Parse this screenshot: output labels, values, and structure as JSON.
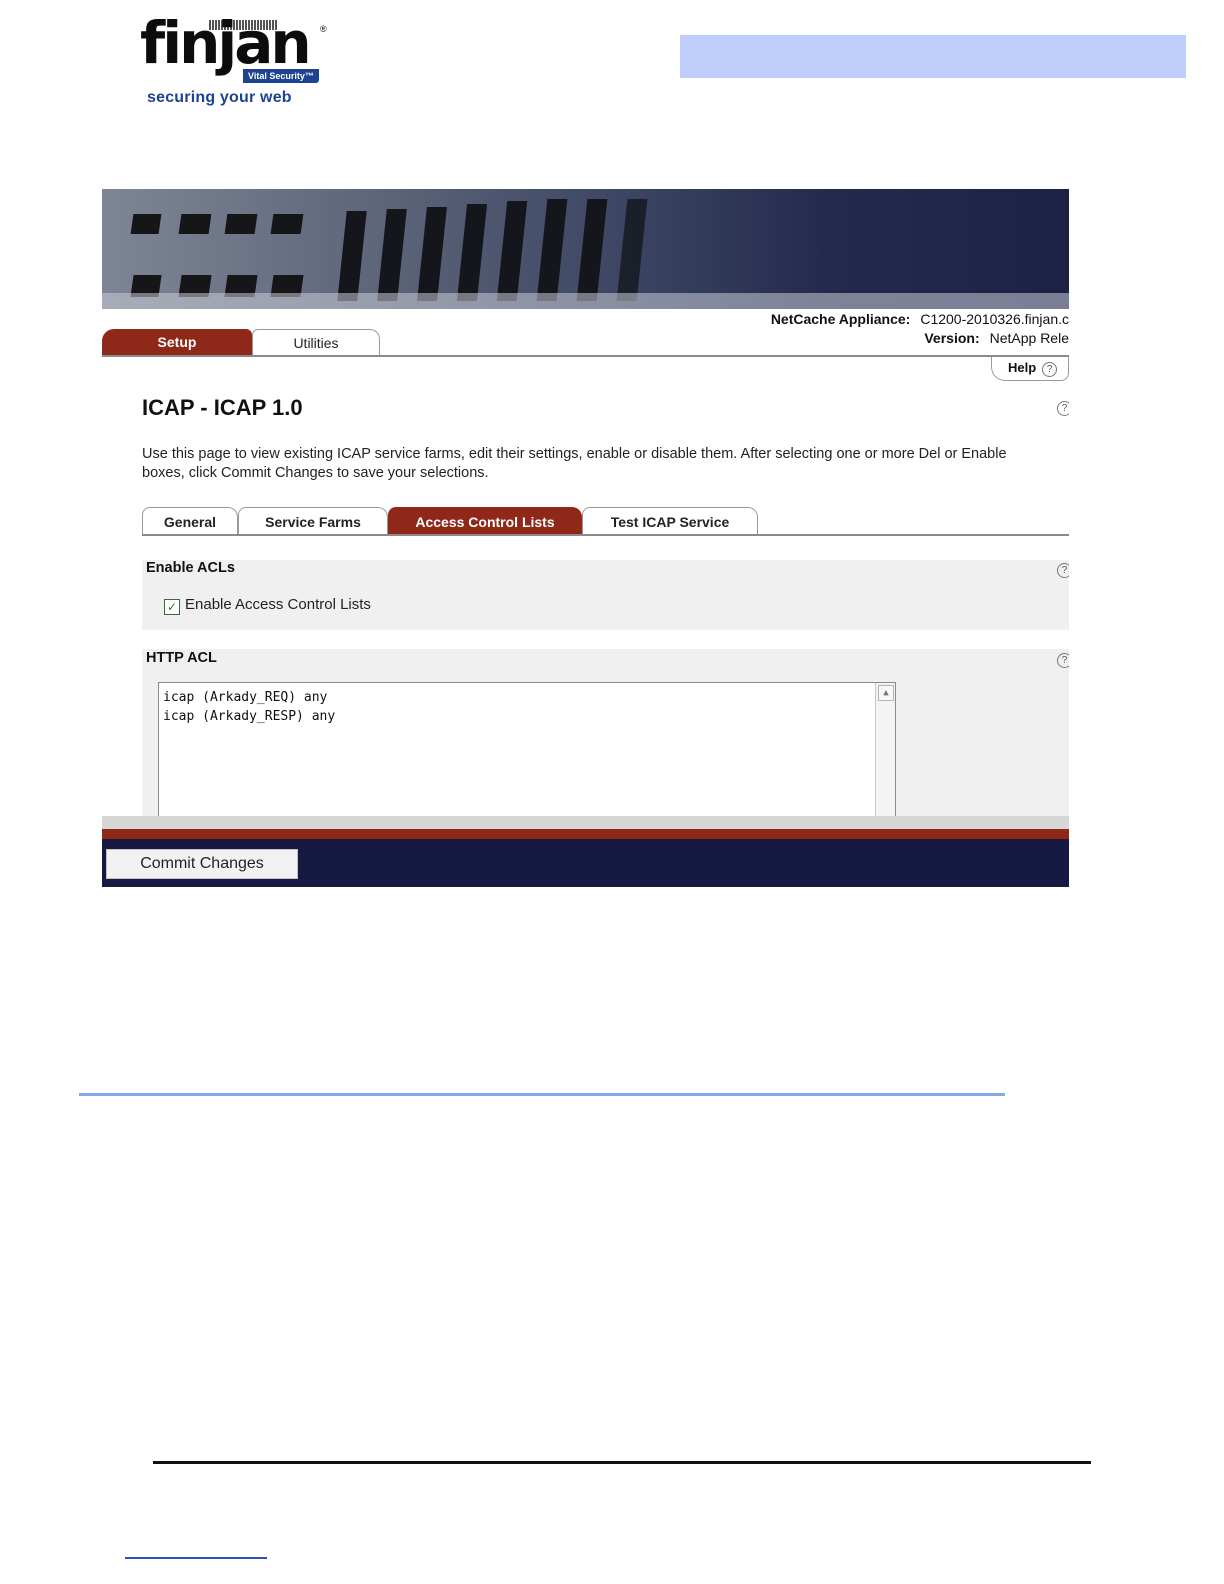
{
  "doc_header": {
    "logo_word": "finjan",
    "logo_badge": "Vital Security™",
    "logo_tagline": "securing your web",
    "header_band_color": "#bfcdfb"
  },
  "app": {
    "appliance_label": "NetCache Appliance:",
    "appliance_value": "C1200-2010326.finjan.c",
    "version_label": "Version:",
    "version_value": "NetApp Rele",
    "main_tabs": [
      {
        "label": "Setup",
        "active": true
      },
      {
        "label": "Utilities",
        "active": false
      }
    ],
    "help_label": "Help",
    "page_title": "ICAP - ICAP 1.0",
    "description_line1": "Use this page to view existing ICAP service farms, edit their settings, enable or disable them. After selecting one or more Del or Enable",
    "description_line2": "boxes, click Commit Changes to save your selections.",
    "sub_tabs": [
      {
        "label": "General",
        "active": false
      },
      {
        "label": "Service Farms",
        "active": false
      },
      {
        "label": "Access Control Lists",
        "active": true
      },
      {
        "label": "Test ICAP Service",
        "active": false
      }
    ],
    "enable_acls": {
      "heading": "Enable ACLs",
      "checkbox_label": "Enable Access Control Lists",
      "checked": true
    },
    "http_acl": {
      "heading": "HTTP ACL",
      "lines": [
        "icap (Arkady_REQ) any",
        "icap (Arkady_RESP) any"
      ]
    },
    "commit_label": "Commit Changes",
    "colors": {
      "tab_active": "#8f2818",
      "footer_navy": "#161941",
      "footer_red": "#8f2818"
    }
  }
}
